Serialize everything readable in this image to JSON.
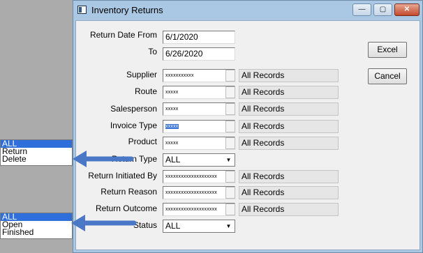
{
  "window": {
    "title": "Inventory Returns",
    "minimize_glyph": "—",
    "maximize_glyph": "▢",
    "close_glyph": "✕"
  },
  "fields": {
    "return_date_from": {
      "label": "Return Date From",
      "value": "6/1/2020"
    },
    "to": {
      "label": "To",
      "value": "6/26/2020"
    },
    "supplier": {
      "label": "Supplier",
      "value": "xxxxxxxxxxx",
      "display": "All Records"
    },
    "route": {
      "label": "Route",
      "value": "xxxxx",
      "display": "All Records"
    },
    "salesperson": {
      "label": "Salesperson",
      "value": "xxxxx",
      "display": "All Records"
    },
    "invoice_type": {
      "label": "Invoice Type",
      "value": "xxxxx",
      "display": "All Records"
    },
    "product": {
      "label": "Product",
      "value": "xxxxx",
      "display": "All Records"
    },
    "return_type": {
      "label": "Return Type",
      "value": "ALL"
    },
    "return_initiated_by": {
      "label": "Return Initiated By",
      "value": "xxxxxxxxxxxxxxxxxxxx",
      "display": "All Records"
    },
    "return_reason": {
      "label": "Return Reason",
      "value": "xxxxxxxxxxxxxxxxxxxx",
      "display": "All Records"
    },
    "return_outcome": {
      "label": "Return Outcome",
      "value": "xxxxxxxxxxxxxxxxxxxx",
      "display": "All Records"
    },
    "status": {
      "label": "Status",
      "value": "ALL"
    }
  },
  "buttons": {
    "excel": "Excel",
    "cancel": "Cancel"
  },
  "return_type_options": [
    "ALL",
    "Return",
    "Delete"
  ],
  "status_options": [
    "ALL",
    "Open",
    "Finished"
  ],
  "colors": {
    "arrow": "#4a78c6",
    "selection": "#2f6fdc"
  }
}
